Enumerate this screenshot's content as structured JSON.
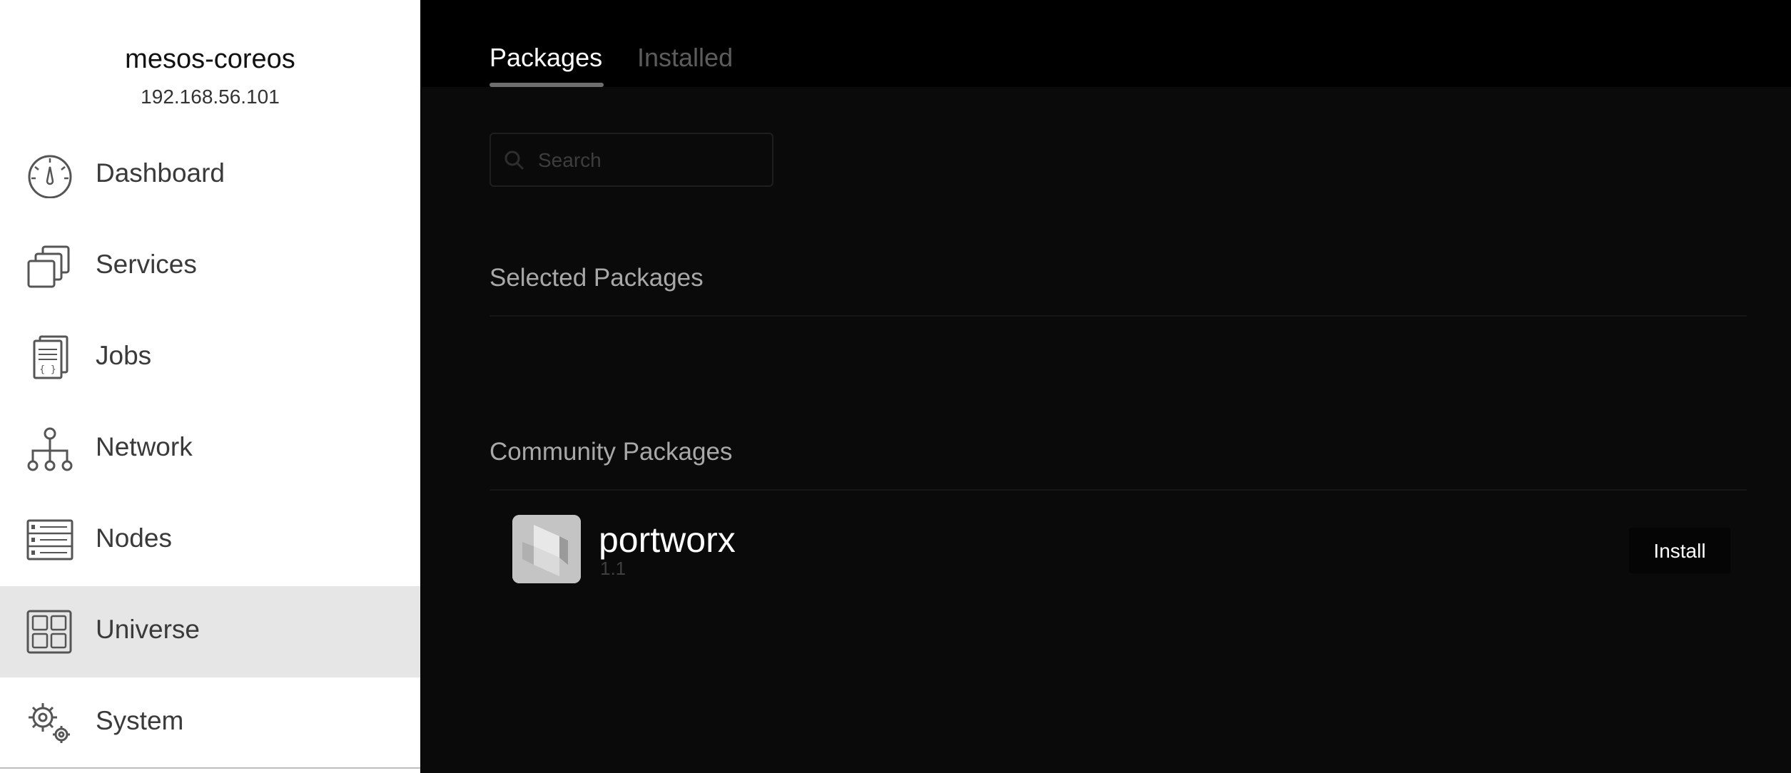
{
  "cluster": {
    "name": "mesos-coreos",
    "ip": "192.168.56.101"
  },
  "sidebar": {
    "items": [
      {
        "label": "Dashboard",
        "icon": "dashboard-gauge-icon",
        "active": false
      },
      {
        "label": "Services",
        "icon": "services-stack-icon",
        "active": false
      },
      {
        "label": "Jobs",
        "icon": "jobs-document-icon",
        "active": false
      },
      {
        "label": "Network",
        "icon": "network-tree-icon",
        "active": false
      },
      {
        "label": "Nodes",
        "icon": "nodes-server-icon",
        "active": false
      },
      {
        "label": "Universe",
        "icon": "universe-grid-icon",
        "active": true
      },
      {
        "label": "System",
        "icon": "system-gears-icon",
        "active": false
      }
    ]
  },
  "tabs": {
    "packages": "Packages",
    "installed": "Installed",
    "active": "Packages"
  },
  "search": {
    "placeholder": "Search",
    "value": ""
  },
  "sections": {
    "selected": "Selected Packages",
    "community": "Community Packages"
  },
  "packages": [
    {
      "name": "portworx",
      "version": "1.1",
      "install_label": "Install",
      "icon": "portworx-logo-icon"
    }
  ],
  "colors": {
    "sidebar_bg": "#ffffff",
    "sidebar_active_bg": "#e6e6e6",
    "main_bg": "#0a0a0a",
    "active_tab": "#ffffff",
    "inactive_tab": "#5c5c5c"
  }
}
